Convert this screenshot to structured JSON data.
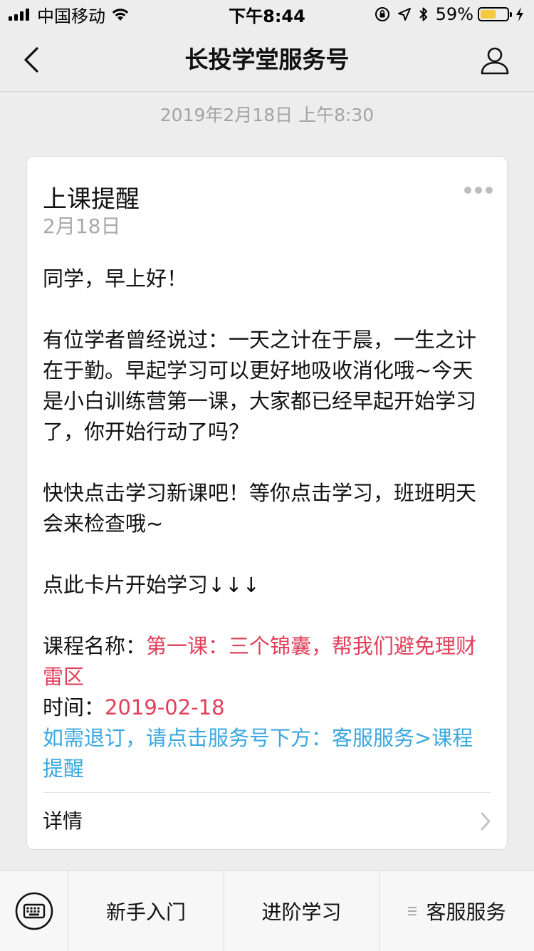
{
  "status_bar": {
    "carrier": "中国移动",
    "time": "下午8:44",
    "battery_percent": "59%",
    "battery_level": 0.59,
    "battery_color": "#f6c93f"
  },
  "nav": {
    "title": "长投学堂服务号",
    "back_icon": "chevron-left-icon",
    "profile_icon": "person-icon"
  },
  "message": {
    "timestamp": "2019年2月18日 上午8:30",
    "card": {
      "title": "上课提醒",
      "date": "2月18日",
      "greeting": "同学，早上好！",
      "paragraph1": "有位学者曾经说过：一天之计在于晨，一生之计在于勤。早起学习可以更好地吸收消化哦~今天是小白训练营第一课，大家都已经早起开始学习了，你开始行动了吗？",
      "paragraph2": "快快点击学习新课吧！等你点击学习，班班明天会来检查哦~",
      "cta": "点此卡片开始学习↓↓↓",
      "course_label": "课程名称：",
      "course_value": "第一课：三个锦囊，帮我们避免理财雷区",
      "time_label": "时间：",
      "time_value": "2019-02-18",
      "unsubscribe": "如需退订，请点击服务号下方：客服服务>课程提醒",
      "detail_label": "详情",
      "highlight_red": "#e0405a",
      "highlight_blue": "#3ba8e0"
    }
  },
  "menu": {
    "keyboard_icon": "keyboard-icon",
    "items": [
      {
        "label": "新手入门"
      },
      {
        "label": "进阶学习"
      },
      {
        "label": "客服服务",
        "icon": "menu-lines-icon"
      }
    ]
  }
}
